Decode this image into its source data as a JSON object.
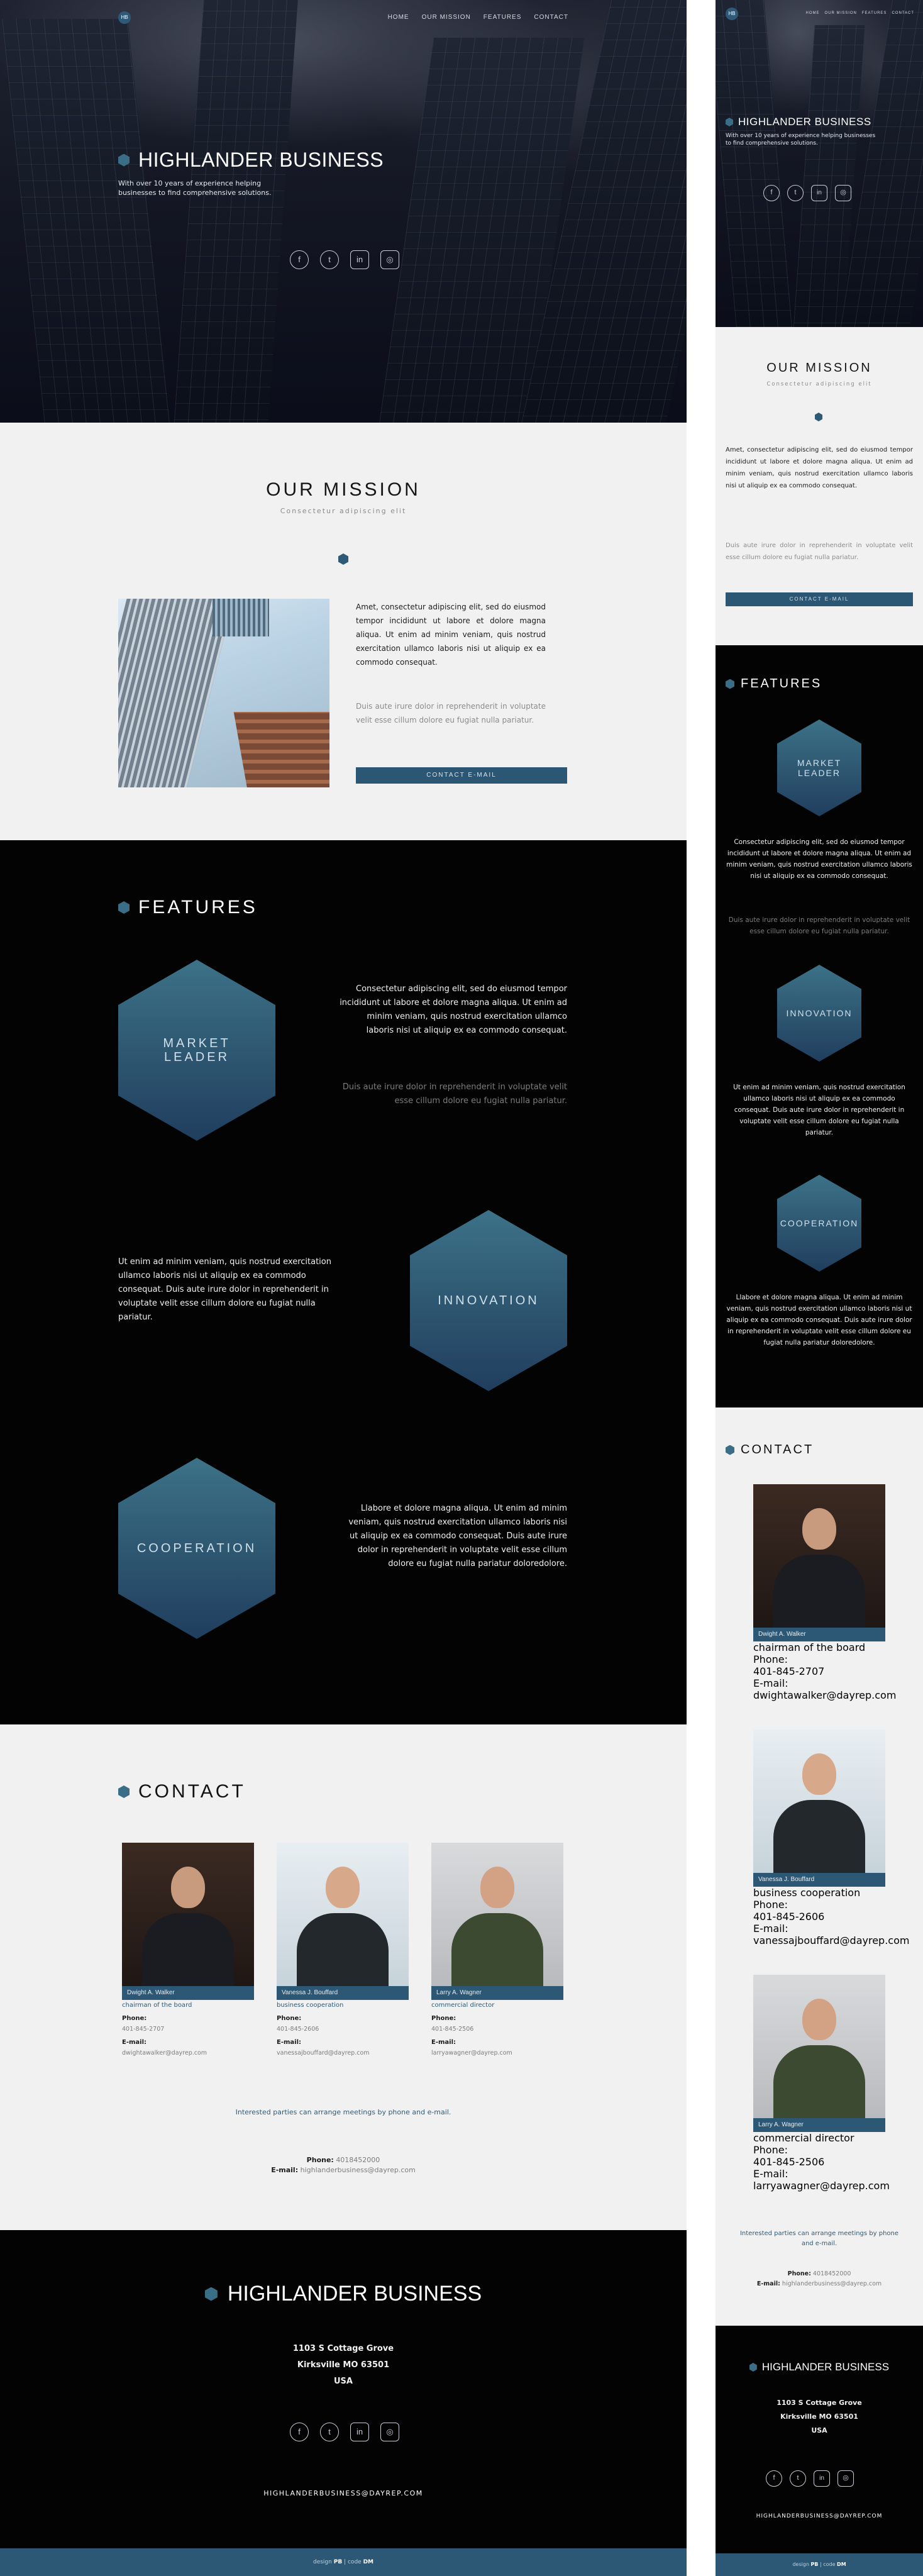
{
  "nav": {
    "logo_text": "HB",
    "links": [
      "HOME",
      "OUR MISSION",
      "FEATURES",
      "CONTACT"
    ]
  },
  "hero": {
    "title": "HIGHLANDER BUSINESS",
    "subtitle": "With over 10 years of experience helping businesses to find comprehensive solutions.",
    "socials": [
      "facebook-icon",
      "twitter-icon",
      "linkedin-icon",
      "instagram-icon"
    ]
  },
  "mission": {
    "title": "OUR MISSION",
    "subtitle": "Consectetur adipiscing elit",
    "para1": "Amet, consectetur adipiscing elit, sed do eiusmod tempor incididunt ut labore et dolore magna aliqua. Ut enim ad minim veniam, quis nostrud exercitation ullamco laboris nisi ut aliquip ex ea commodo consequat.",
    "para2": "Duis aute irure dolor in reprehenderit in voluptate velit esse cillum dolore eu fugiat nulla pariatur.",
    "button": "CONTACT E-MAIL"
  },
  "features": {
    "title": "FEATURES",
    "items": [
      {
        "label": "MARKET LEADER",
        "text": "Consectetur adipiscing elit, sed do eiusmod tempor incididunt ut labore et dolore magna aliqua. Ut enim ad minim veniam, quis nostrud exercitation ullamco laboris nisi ut aliquip ex ea commodo consequat.",
        "muted": "Duis aute irure dolor in reprehenderit in voluptate velit esse cillum dolore eu fugiat nulla pariatur."
      },
      {
        "label": "INNOVATION",
        "text": "Ut enim ad minim veniam, quis nostrud exercitation ullamco laboris nisi ut aliquip ex ea commodo consequat. Duis aute irure dolor in reprehenderit in voluptate velit esse cillum dolore eu fugiat nulla pariatur."
      },
      {
        "label": "COOPERATION",
        "text": "Llabore et dolore magna aliqua. Ut enim ad minim veniam, quis nostrud exercitation ullamco laboris nisi ut aliquip ex ea commodo consequat. Duis aute irure dolor in reprehenderit in voluptate velit esse cillum dolore eu fugiat nulla pariatur doloredolore."
      }
    ]
  },
  "contact": {
    "title": "CONTACT",
    "phone_label": "Phone:",
    "email_label": "E-mail:",
    "people": [
      {
        "name": "Dwight A. Walker",
        "role": "chairman of the board",
        "phone": "401-845-2707",
        "email": "dwightawalker@dayrep.com"
      },
      {
        "name": "Vanessa J. Bouffard",
        "role": "business cooperation",
        "phone": "401-845-2606",
        "email": "vanessajbouffard@dayrep.com"
      },
      {
        "name": "Larry A. Wagner",
        "role": "commercial director",
        "phone": "401-845-2506",
        "email": "larryawagner@dayrep.com"
      }
    ],
    "note": "Interested parties can arrange meetings by phone and e-mail.",
    "main_phone_label": "Phone:",
    "main_phone": "4018452000",
    "main_email_label": "E-mail:",
    "main_email": "highlanderbusiness@dayrep.com"
  },
  "footer": {
    "title": "HIGHLANDER BUSINESS",
    "address_line1": "1103 S Cottage Grove",
    "address_line2": "Kirksville MO 63501",
    "address_line3": "USA",
    "email": "HIGHLANDERBUSINESS@DAYREP.COM",
    "credit_design": "design",
    "credit_design_by": "PB",
    "credit_sep": "|",
    "credit_code": "code",
    "credit_code_by": "DM"
  },
  "colors": {
    "accent": "#2c5775",
    "hex_gradient_top": "#3c7287",
    "dark": "#030303",
    "light": "#f1f1f1"
  }
}
